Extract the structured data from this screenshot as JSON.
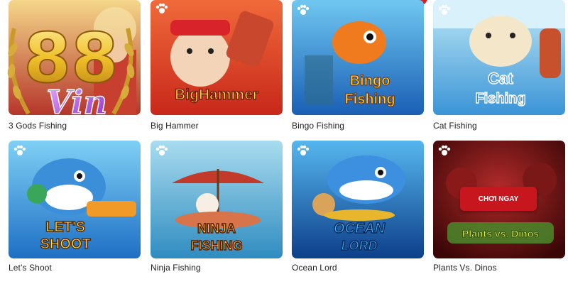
{
  "brand": {
    "number": "88",
    "script": "Vin"
  },
  "games": [
    {
      "caption": "3 Gods Fishing",
      "art_title": "",
      "accent": "#c0392b"
    },
    {
      "caption": "Big Hammer",
      "art_title": "BigHammer",
      "accent": "#e23a1e"
    },
    {
      "caption": "Bingo Fishing",
      "art_title_1": "Bingo",
      "art_title_2": "Fishing",
      "accent": "#1f6fd1"
    },
    {
      "caption": "Cat Fishing",
      "art_title_1": "Cat",
      "art_title_2": "Fishing",
      "accent": "#2b8fe0"
    },
    {
      "caption": "Let’s Shoot",
      "art_title_1": "LET'S",
      "art_title_2": "SHOOT",
      "accent": "#2a7fd4"
    },
    {
      "caption": "Ninja Fishing",
      "art_title_1": "NINJA",
      "art_title_2": "FISHING",
      "accent": "#3a8fc4"
    },
    {
      "caption": "Ocean Lord",
      "art_title_1": "OCEAN",
      "art_title_2": "LORD",
      "accent": "#0f5fb8"
    },
    {
      "caption": "Plants Vs. Dinos",
      "art_title": "Plants vs. Dinos",
      "accent": "#7a1010"
    }
  ],
  "play_button": {
    "label": "CHƠI NGAY"
  },
  "colors": {
    "play": "#c8161e",
    "brand_gold": "#f0c02a",
    "brand_purple": "#a64bd6"
  }
}
